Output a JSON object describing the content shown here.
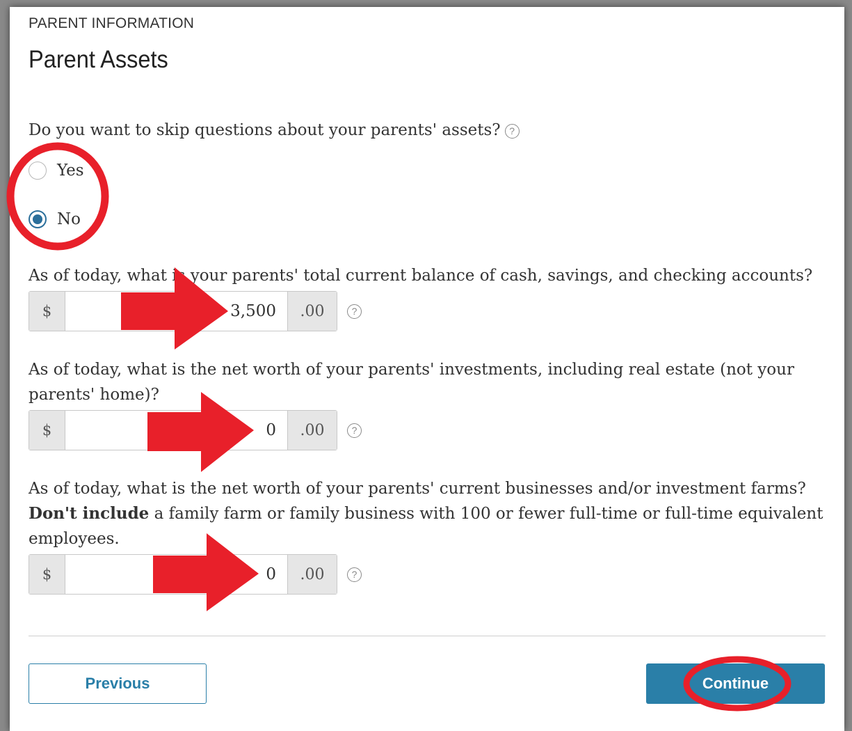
{
  "header": {
    "section_label": "PARENT INFORMATION",
    "title": "Parent Assets"
  },
  "skip_question": {
    "text": "Do you want to skip questions about your parents' assets?",
    "help_icon": "question-circle-icon",
    "options": [
      {
        "label": "Yes",
        "selected": false
      },
      {
        "label": "No",
        "selected": true
      }
    ]
  },
  "fields": [
    {
      "question": "As of today, what is your parents' total current balance of cash, savings, and checking accounts?",
      "prefix": "$",
      "value": "3,500",
      "suffix": ".00"
    },
    {
      "question": "As of today, what is the net worth of your parents' investments, including real estate (not your parents' home)?",
      "prefix": "$",
      "value": "0",
      "suffix": ".00"
    },
    {
      "question_bold": "Don't include",
      "question_part1": "As of today, what is the net worth of your parents' current businesses and/or investment farms?",
      "question_part2": "a family farm or family business with 100 or fewer full-time or full-time equivalent employees.",
      "prefix": "$",
      "value": "0",
      "suffix": ".00"
    }
  ],
  "buttons": {
    "previous": "Previous",
    "continue": "Continue"
  },
  "annotations": {
    "highlight_color": "#e8202a",
    "radio_circle": "circle-highlight",
    "continue_circle": "circle-highlight",
    "arrows": [
      "arrow-right",
      "arrow-right",
      "arrow-right"
    ]
  },
  "colors": {
    "accent": "#2a7fa8",
    "radio_selected": "#2b6f9b"
  }
}
